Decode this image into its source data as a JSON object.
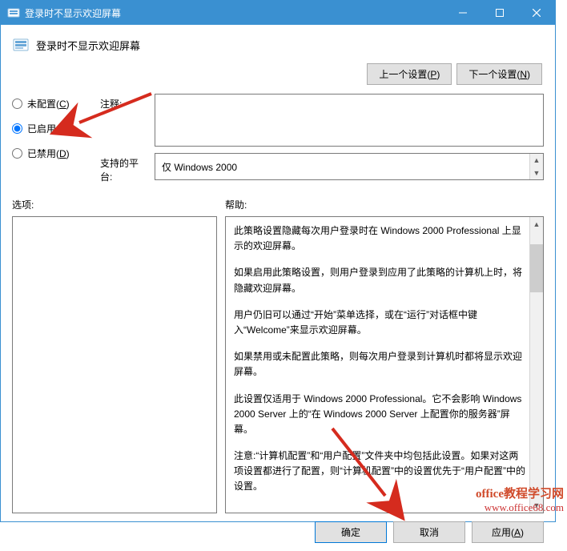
{
  "titlebar": {
    "title": "登录时不显示欢迎屏幕"
  },
  "header": {
    "title": "登录时不显示欢迎屏幕"
  },
  "nav": {
    "prev": "上一个设置(P)",
    "next": "下一个设置(N)"
  },
  "radios": {
    "not_configured": "未配置(C)",
    "enabled": "已启用(E)",
    "disabled": "已禁用(D)",
    "selected": "enabled"
  },
  "comment": {
    "label": "注释:",
    "value": ""
  },
  "platform": {
    "label": "支持的平台:",
    "value": "仅 Windows 2000"
  },
  "panes": {
    "options_label": "选项:",
    "help_label": "帮助:"
  },
  "help": {
    "p1": "此策略设置隐藏每次用户登录时在 Windows 2000 Professional 上显示的欢迎屏幕。",
    "p2": "如果启用此策略设置，则用户登录到应用了此策略的计算机上时，将隐藏欢迎屏幕。",
    "p3": "用户仍旧可以通过“开始”菜单选择，或在“运行”对话框中键入“Welcome”来显示欢迎屏幕。",
    "p4": "如果禁用或未配置此策略，则每次用户登录到计算机时都将显示欢迎屏幕。",
    "p5": "此设置仅适用于 Windows 2000 Professional。它不会影响 Windows 2000 Server 上的“在 Windows 2000 Server 上配置你的服务器”屏幕。",
    "p6": "注意:“计算机配置”和“用户配置”文件夹中均包括此设置。如果对这两项设置都进行了配置，则“计算机配置”中的设置优先于“用户配置”中的设置。"
  },
  "footer": {
    "ok": "确定",
    "cancel": "取消",
    "apply": "应用(A)"
  },
  "watermark": {
    "line1": "office教程学习网",
    "line2": "www.office68.com"
  }
}
